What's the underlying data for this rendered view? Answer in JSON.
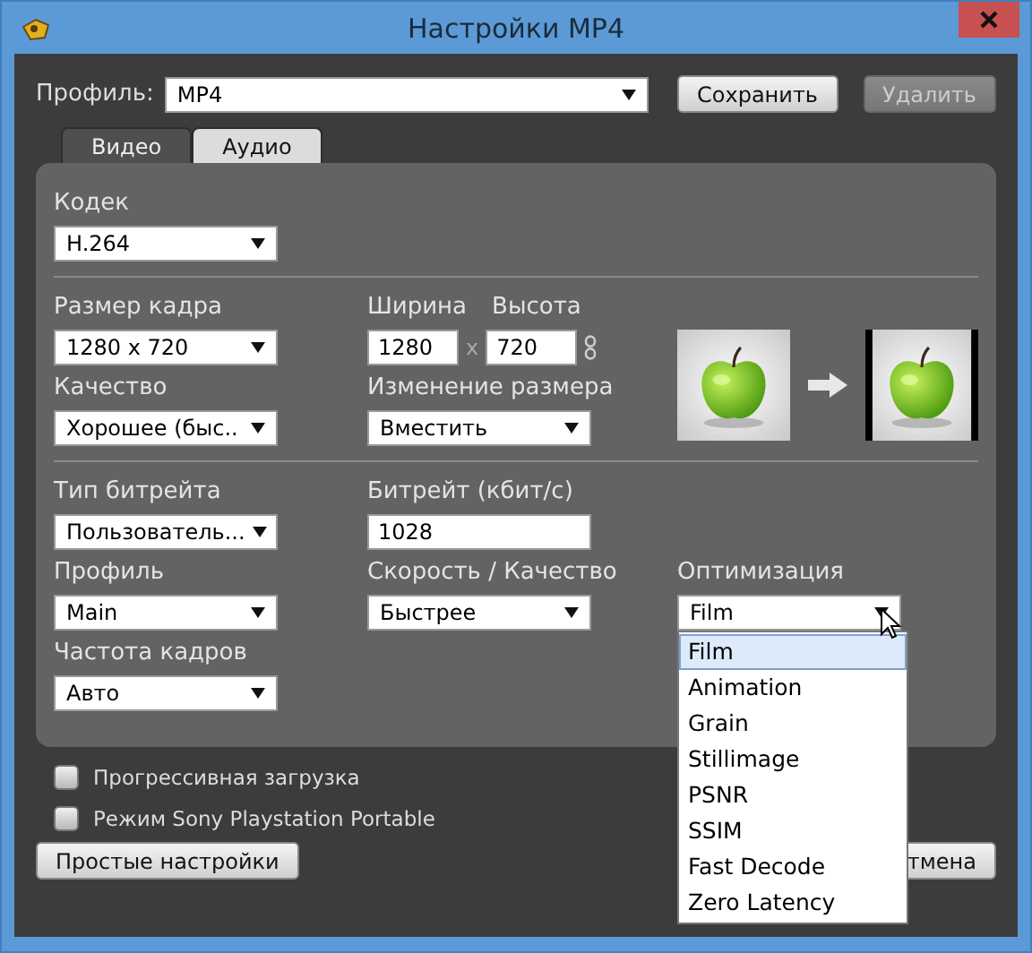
{
  "window": {
    "title": "Настройки MP4"
  },
  "profile": {
    "label": "Профиль:",
    "value": "MP4"
  },
  "header_buttons": [
    {
      "label": "Сохранить",
      "disabled": false
    },
    {
      "label": "Удалить",
      "disabled": true
    }
  ],
  "tabs": [
    {
      "label": "Видео",
      "selected": true
    },
    {
      "label": "Аудио",
      "selected": false
    }
  ],
  "groups": [
    {
      "rows": [
        [
          {
            "kind": "select",
            "label": "Кодек",
            "value": "H.264"
          }
        ]
      ]
    },
    {
      "preview": {
        "kind": "picture"
      },
      "rows": [
        [
          {
            "kind": "select",
            "label": "Размер кадра",
            "value": "1280 x 720"
          },
          {
            "kind": "size",
            "labels": [
              "Ширина",
              "Высота"
            ],
            "values": [
              "1280",
              "720"
            ],
            "separator": "x"
          }
        ],
        [
          {
            "kind": "select",
            "label": "Качество",
            "value": "Хорошее (быс.."
          },
          {
            "kind": "select",
            "label": "Изменение размера",
            "value": "Вместить"
          }
        ]
      ]
    },
    {
      "rows": [
        [
          {
            "kind": "select",
            "label": "Тип битрейта",
            "value": "Пользователь..."
          },
          {
            "kind": "input",
            "label": "Битрейт (кбит/с)",
            "value": "1028"
          }
        ],
        [
          {
            "kind": "select",
            "label": "Профиль",
            "value": "Main"
          },
          {
            "kind": "select",
            "label": "Скорость / Качество",
            "value": "Быстрее"
          },
          {
            "kind": "select",
            "label": "Оптимизация",
            "value": "Film",
            "open": true,
            "options": [
              {
                "label": "Film",
                "selected": true
              },
              {
                "label": "Animation",
                "selected": false
              },
              {
                "label": "Grain",
                "selected": false
              },
              {
                "label": "Stillimage",
                "selected": false
              },
              {
                "label": "PSNR",
                "selected": false
              },
              {
                "label": "SSIM",
                "selected": false
              },
              {
                "label": "Fast Decode",
                "selected": false
              },
              {
                "label": "Zero Latency",
                "selected": false
              }
            ]
          }
        ],
        [
          {
            "kind": "select",
            "label": "Частота кадров",
            "value": "Авто"
          }
        ]
      ]
    }
  ],
  "checkboxes": [
    {
      "label": "Прогрессивная загрузка",
      "checked": false
    },
    {
      "label": "Режим Sony Playstation Portable",
      "checked": false
    }
  ],
  "footer_buttons": [
    {
      "label": "Простые настройки"
    },
    {
      "label": "тмена"
    }
  ]
}
